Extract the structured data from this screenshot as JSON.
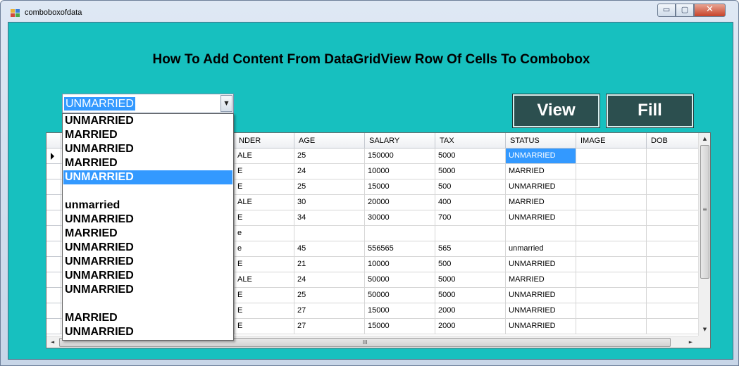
{
  "window": {
    "title": "comboboxofdata",
    "min_glyph": "▭",
    "max_glyph": "▢",
    "close_glyph": "✕"
  },
  "heading": "How To Add Content From DataGridView Row Of Cells To Combobox",
  "buttons": {
    "view": "View",
    "fill": "Fill"
  },
  "combobox": {
    "value": "UNMARRIED",
    "items": [
      "UNMARRIED",
      "MARRIED",
      "UNMARRIED",
      "MARRIED",
      "UNMARRIED",
      "",
      "unmarried",
      "UNMARRIED",
      "MARRIED",
      "UNMARRIED",
      "UNMARRIED",
      "UNMARRIED",
      "UNMARRIED",
      "",
      "MARRIED",
      "UNMARRIED"
    ],
    "highlighted_index": 4
  },
  "grid": {
    "columns": [
      "NDER",
      "AGE",
      "SALARY",
      "TAX",
      "STATUS",
      "IMAGE",
      "DOB"
    ],
    "rows": [
      [
        "ALE",
        "25",
        "150000",
        "5000",
        "UNMARRIED",
        "",
        ""
      ],
      [
        "E",
        "24",
        "10000",
        "5000",
        "MARRIED",
        "",
        ""
      ],
      [
        "E",
        "25",
        "15000",
        "500",
        "UNMARRIED",
        "",
        ""
      ],
      [
        "ALE",
        "30",
        "20000",
        "400",
        "MARRIED",
        "",
        ""
      ],
      [
        "E",
        "34",
        "30000",
        "700",
        "UNMARRIED",
        "",
        ""
      ],
      [
        "e",
        "",
        "",
        "",
        "",
        "",
        ""
      ],
      [
        "e",
        "45",
        "556565",
        "565",
        "unmarried",
        "",
        ""
      ],
      [
        "E",
        "21",
        "10000",
        "500",
        "UNMARRIED",
        "",
        ""
      ],
      [
        "ALE",
        "24",
        "50000",
        "5000",
        "MARRIED",
        "",
        ""
      ],
      [
        "E",
        "25",
        "50000",
        "5000",
        "UNMARRIED",
        "",
        ""
      ],
      [
        "E",
        "27",
        "15000",
        "2000",
        "UNMARRIED",
        "",
        ""
      ],
      [
        "E",
        "27",
        "15000",
        "2000",
        "UNMARRIED",
        "",
        ""
      ]
    ],
    "selected_row": 0,
    "selected_col": 4,
    "scroll_glyphs": {
      "up": "▲",
      "down": "▼",
      "left": "◄",
      "right": "►",
      "vgrip": "≡",
      "hgrip": "III"
    }
  },
  "colors": {
    "client_bg": "#17c0bf",
    "button_bg": "#2c4f4f",
    "selection": "#3399ff"
  }
}
